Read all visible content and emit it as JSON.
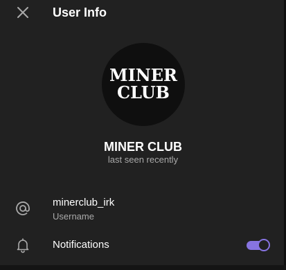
{
  "header": {
    "title": "User Info",
    "close_icon": "close-icon"
  },
  "profile": {
    "logo_line1": "MINER",
    "logo_line2": "CLUB",
    "name": "MINER CLUB",
    "status": "last seen recently"
  },
  "details": {
    "username": {
      "icon": "at-icon",
      "value": "minerclub_irk",
      "caption": "Username"
    },
    "notifications": {
      "icon": "bell-icon",
      "label": "Notifications",
      "enabled": true
    }
  },
  "colors": {
    "background": "#212121",
    "accent": "#8774e1",
    "text_primary": "#ffffff",
    "text_secondary": "#aaaaaa"
  }
}
